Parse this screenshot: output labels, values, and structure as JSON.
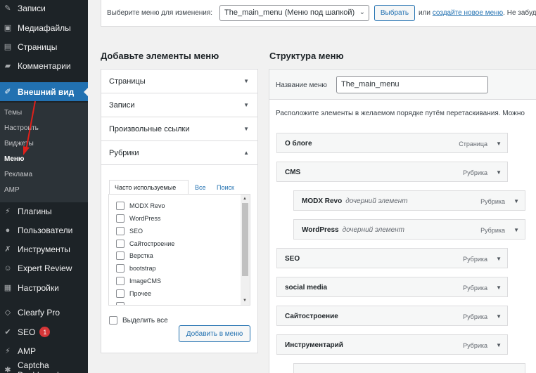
{
  "sidebar": {
    "items": [
      {
        "label": "Записи",
        "icon": "pushpin-icon"
      },
      {
        "label": "Медиафайлы",
        "icon": "media-icon"
      },
      {
        "label": "Страницы",
        "icon": "page-icon"
      },
      {
        "label": "Комментарии",
        "icon": "comment-icon"
      },
      {
        "label": "Внешний вид",
        "icon": "paintbrush-icon"
      },
      {
        "label": "Плагины",
        "icon": "plugin-icon"
      },
      {
        "label": "Пользователи",
        "icon": "users-icon"
      },
      {
        "label": "Инструменты",
        "icon": "wrench-icon"
      },
      {
        "label": "Expert Review",
        "icon": "review-icon"
      },
      {
        "label": "Настройки",
        "icon": "settings-icon"
      },
      {
        "label": "Clearfy Pro",
        "icon": "diamond-icon"
      },
      {
        "label": "SEO",
        "icon": "seo-icon",
        "badge": "1"
      },
      {
        "label": "AMP",
        "icon": "amp-icon"
      },
      {
        "label": "Captcha Dashboard",
        "icon": "captcha-icon"
      }
    ],
    "submenu": [
      "Темы",
      "Настроить",
      "Виджеты",
      "Меню",
      "Реклама",
      "AMP"
    ]
  },
  "topbar": {
    "label": "Выберите меню для изменения:",
    "selected_menu": "The_main_menu (Меню под шапкой)",
    "select_button": "Выбрать",
    "or_text": "или",
    "create_link": "создайте новое меню",
    "tail_text": ". Не забуд"
  },
  "left": {
    "heading": "Добавьте элементы меню",
    "sections": [
      "Страницы",
      "Записи",
      "Произвольные ссылки",
      "Рубрики"
    ],
    "tabs": [
      "Часто используемые",
      "Все",
      "Поиск"
    ],
    "categories": [
      "MODX Revo",
      "WordPress",
      "SEO",
      "Сайтостроение",
      "Верстка",
      "bootstrap",
      "ImageCMS",
      "Прочее"
    ],
    "select_all": "Выделить все",
    "add_button": "Добавить в меню"
  },
  "right": {
    "heading": "Структура меню",
    "name_label": "Название меню",
    "name_value": "The_main_menu",
    "hint": "Расположите элементы в желаемом порядке путём перетаскивания. Можно",
    "items": [
      {
        "title": "О блоге",
        "sub": "",
        "type": "Страница"
      },
      {
        "title": "CMS",
        "sub": "",
        "type": "Рубрика"
      },
      {
        "title": "MODX Revo",
        "sub": "дочерний элемент",
        "type": "Рубрика"
      },
      {
        "title": "WordPress",
        "sub": "дочерний элемент",
        "type": "Рубрика"
      },
      {
        "title": "SEO",
        "sub": "",
        "type": "Рубрика"
      },
      {
        "title": "social media",
        "sub": "",
        "type": "Рубрика"
      },
      {
        "title": "Сайтостроение",
        "sub": "",
        "type": "Рубрика"
      },
      {
        "title": "Инструментарий",
        "sub": "",
        "type": "Рубрика"
      }
    ]
  },
  "colors": {
    "sidebar_bg": "#1d2327",
    "active_bg": "#2271b1",
    "link": "#2271b1",
    "annotation_arrow": "#e0201b"
  }
}
